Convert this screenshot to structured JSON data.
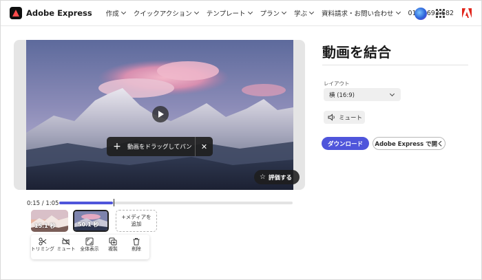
{
  "header": {
    "brand": "Adobe Express",
    "nav": [
      {
        "label": "作成"
      },
      {
        "label": "クイックアクション"
      },
      {
        "label": "テンプレート"
      },
      {
        "label": "プラン"
      },
      {
        "label": "学ぶ"
      },
      {
        "label": "資料請求・お問い合わせ"
      }
    ],
    "phone": "0120 693 682"
  },
  "preview": {
    "drag_label": "動画をドラッグしてパン",
    "rate_label": "評価する"
  },
  "timeline": {
    "time": "0:15 / 1:05",
    "progress": 0.23,
    "clips": [
      {
        "duration": "15.1 秒"
      },
      {
        "duration": "50.1 秒"
      }
    ],
    "add_media": "+メディアを\n追加"
  },
  "tools": [
    {
      "label": "トリミング",
      "icon": "trim-icon"
    },
    {
      "label": "ミュート",
      "icon": "mute-icon"
    },
    {
      "label": "全体表示",
      "icon": "fit-icon"
    },
    {
      "label": "複製",
      "icon": "duplicate-icon"
    },
    {
      "label": "削除",
      "icon": "trash-icon"
    }
  ],
  "panel": {
    "title": "動画を結合",
    "layout_label": "レイアウト",
    "layout_value": "横 (16:9)",
    "mute_label": "ミュート",
    "download_label": "ダウンロード",
    "open_label": "Adobe Express で開く"
  },
  "colors": {
    "accent": "#4f55db"
  }
}
